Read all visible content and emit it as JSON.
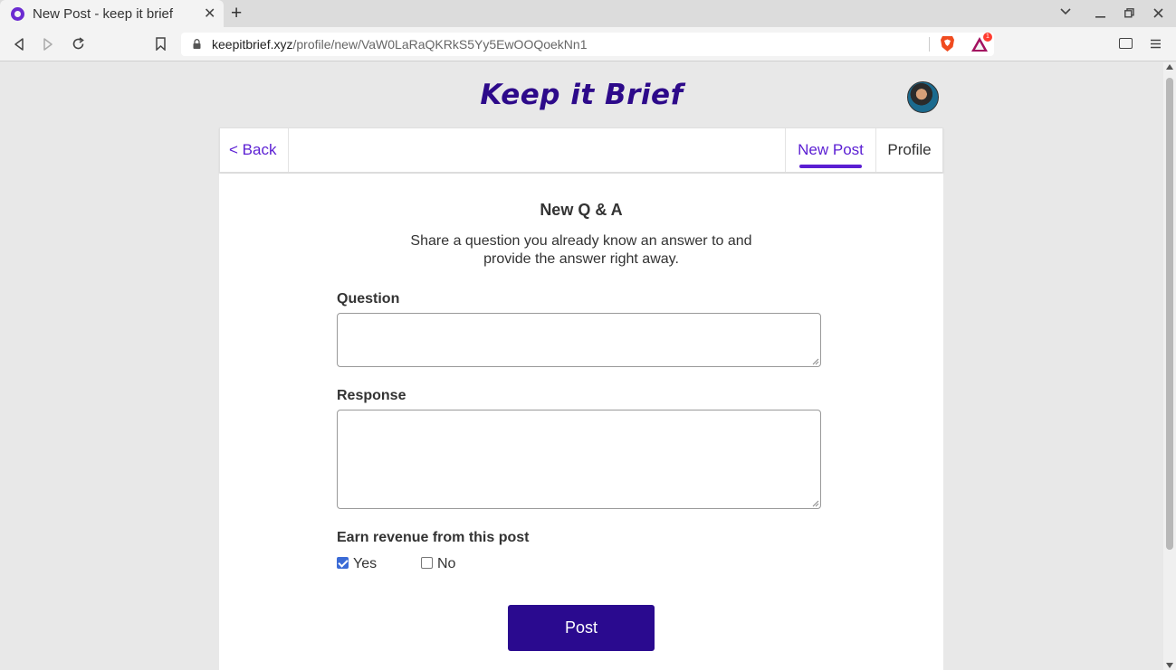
{
  "browser": {
    "tab_title": "New Post - keep it brief",
    "tab_close": "✕",
    "new_tab": "+",
    "url_host": "keepitbrief.xyz",
    "url_path": "/profile/new/VaW0LaRaQKRkS5Yy5EwOOQoekNn1",
    "rewards_count": "1",
    "colors": {
      "favicon": "#6b2bd1",
      "brave": "#f04b1f",
      "rewards_badge": "#ff3b2f"
    }
  },
  "site": {
    "logo": "Keep it Brief",
    "colors": {
      "brand": "#2d0a8a",
      "accent": "#5b1ed3",
      "button": "#2a0a8f"
    }
  },
  "nav": {
    "back_label": "<  Back",
    "tabs": [
      {
        "label": "New Post",
        "active": true
      },
      {
        "label": "Profile",
        "active": false
      }
    ]
  },
  "form": {
    "title": "New Q & A",
    "description": "Share a question you already know an answer to and provide the answer right away.",
    "question_label": "Question",
    "question_value": "",
    "response_label": "Response",
    "response_value": "",
    "revenue_label": "Earn revenue from this post",
    "options": [
      {
        "label": "Yes",
        "checked": true
      },
      {
        "label": "No",
        "checked": false
      }
    ],
    "submit_label": "Post"
  }
}
